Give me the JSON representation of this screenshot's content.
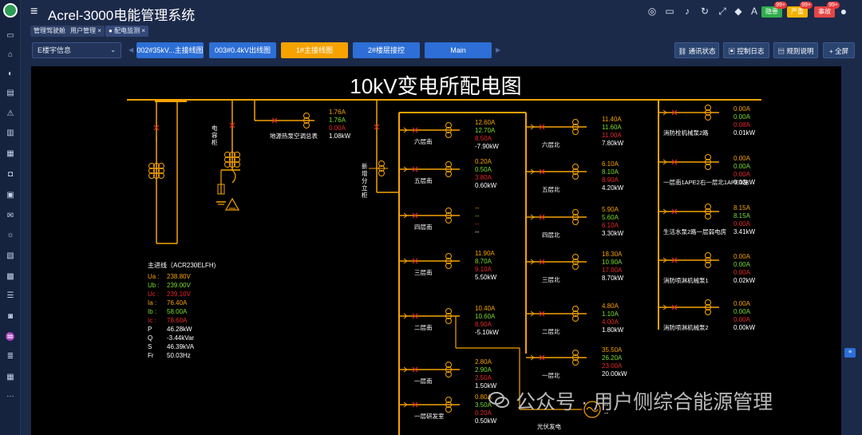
{
  "app": {
    "title": "Acrel-3000电能管理系统"
  },
  "alarms": [
    {
      "label": "隐患",
      "count": "99+",
      "color": "#2fae4a"
    },
    {
      "label": "严重",
      "count": "99+",
      "color": "#f6b400"
    },
    {
      "label": "事故",
      "count": "99+",
      "color": "#e64545"
    }
  ],
  "tabs": [
    {
      "label": "管理驾驶舱"
    },
    {
      "label": "用户管理",
      "close": "×"
    },
    {
      "label": "配电监测",
      "close": "×"
    }
  ],
  "toolbar": {
    "building_select": "E楼宇信息",
    "views": [
      "002#35kV...主接线图",
      "003#0.4kV出线图",
      "1#主接线图",
      "2#楼层接控",
      "Main"
    ],
    "active_view": "1#主接线图",
    "actions": [
      "通讯状态",
      "控制日志",
      "规则说明",
      "全屏"
    ]
  },
  "diagram": {
    "title": "10kV变电所配电图",
    "capacitor_label": "电容柜",
    "newbuild_label": "新增分立柜",
    "main_feed": {
      "title": "主进线（ACR230ELFH)",
      "rows": [
        {
          "k": "Ua :",
          "v": "238.80V",
          "c": "#f6a300"
        },
        {
          "k": "Ub :",
          "v": "239.00V",
          "c": "#7bdc2e"
        },
        {
          "k": "Uc :",
          "v": "239.10V",
          "c": "#e52828"
        },
        {
          "k": "Ia :",
          "v": "76.40A",
          "c": "#f6a300"
        },
        {
          "k": "Ib :",
          "v": "58.00A",
          "c": "#7bdc2e"
        },
        {
          "k": "Ic :",
          "v": "78.60A",
          "c": "#e52828"
        },
        {
          "k": "P",
          "v": "46.28kW",
          "c": "#ffffff"
        },
        {
          "k": "Q",
          "v": "-3.44kVar",
          "c": "#ffffff"
        },
        {
          "k": "S",
          "v": "46.39kVA",
          "c": "#ffffff"
        },
        {
          "k": "Fr",
          "v": "50.03Hz",
          "c": "#ffffff"
        }
      ]
    },
    "top_feeder": {
      "name": "地源热泵空调总表",
      "a": "1.76A",
      "b": "1.76A",
      "c": "0.00A",
      "p": "1.08kW"
    },
    "left_feeders": [
      {
        "name": "六层南",
        "a": "12.60A",
        "b": "12.70A",
        "c": "8.50A",
        "p": "-7.90kW"
      },
      {
        "name": "五层南",
        "a": "0.20A",
        "b": "0.50A",
        "c": "3.80A",
        "p": "0.60kW"
      },
      {
        "name": "四层南",
        "a": "--",
        "b": "--",
        "c": "--",
        "p": "--"
      },
      {
        "name": "三层南",
        "a": "11.90A",
        "b": "8.70A",
        "c": "9.10A",
        "p": "5.50kW"
      },
      {
        "name": "二层南",
        "a": "10.40A",
        "b": "10.60A",
        "c": "8.90A",
        "p": "-5.10kW"
      },
      {
        "name": "一层南",
        "a": "2.80A",
        "b": "2.90A",
        "c": "2.50A",
        "p": "1.50kW"
      },
      {
        "name": "一层研发室",
        "a": "0.80A",
        "b": "3.50A",
        "c": "0.20A",
        "p": "0.50kW"
      }
    ],
    "mid_feeders": [
      {
        "name": "六层北",
        "a": "11.40A",
        "b": "11.60A",
        "c": "11.00A",
        "p": "7.80kW"
      },
      {
        "name": "五层北",
        "a": "6.10A",
        "b": "8.10A",
        "c": "8.90A",
        "p": "4.20kW"
      },
      {
        "name": "四层北",
        "a": "5.90A",
        "b": "5.60A",
        "c": "6.10A",
        "p": "3.30kW"
      },
      {
        "name": "三层北",
        "a": "18.30A",
        "b": "10.90A",
        "c": "17.00A",
        "p": "8.70kW"
      },
      {
        "name": "二层北",
        "a": "4.80A",
        "b": "1.10A",
        "c": "4.00A",
        "p": "1.80kW"
      },
      {
        "name": "一层北",
        "a": "35.50A",
        "b": "26.20A",
        "c": "23.00A",
        "p": "20.00kW"
      },
      {
        "name": "光伏发电",
        "a": "--",
        "b": "--",
        "c": "--",
        "p": "--"
      }
    ],
    "right_feeders": [
      {
        "name": "消防栓机械泵2路",
        "a": "0.00A",
        "b": "0.00A",
        "c": "0.08A",
        "p": "0.01kW"
      },
      {
        "name": "一层南1APE2右一层北1APE1左",
        "a": "0.00A",
        "b": "0.00A",
        "c": "0.00A",
        "p": "0.00kW"
      },
      {
        "name": "生活水泵2路一层弱电房",
        "a": "8.15A",
        "b": "8.15A",
        "c": "0.00A",
        "p": "3.41kW"
      },
      {
        "name": "消防喷淋机械泵1",
        "a": "0.00A",
        "b": "0.00A",
        "c": "0.00A",
        "p": "0.02kW"
      },
      {
        "name": "消防喷淋机械泵2",
        "a": "0.00A",
        "b": "0.00A",
        "c": "0.00A",
        "p": "0.00kW"
      }
    ]
  },
  "watermark": {
    "text": "公众号 · 用户侧综合能源管理"
  }
}
